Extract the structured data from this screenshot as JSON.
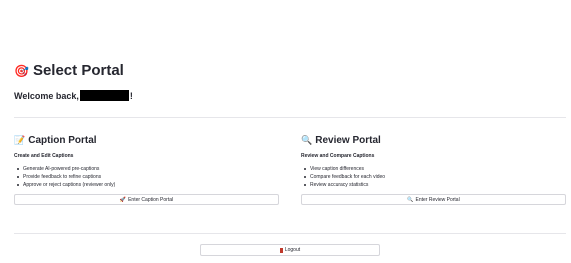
{
  "header": {
    "title": "Select Portal",
    "title_icon": "target-icon",
    "welcome_prefix": "Welcome back,",
    "welcome_suffix": "!"
  },
  "caption_portal": {
    "icon": "memo-icon",
    "title": "Caption Portal",
    "subtitle": "Create and Edit Captions",
    "bullets": [
      "Generate AI-powered pre-captions",
      "Provide feedback to refine captions",
      "Approve or reject captions (reviewer only)"
    ],
    "button_label": "Enter Caption Portal",
    "button_icon": "rocket-icon"
  },
  "review_portal": {
    "icon": "magnifier-icon",
    "title": "Review Portal",
    "subtitle": "Review and Compare Captions",
    "bullets": [
      "View caption differences",
      "Compare feedback for each video",
      "Review accuracy statistics"
    ],
    "button_label": "Enter Review Portal",
    "button_icon": "magnifier-icon"
  },
  "logout": {
    "label": "Logout",
    "icon": "door-icon"
  },
  "colors": {
    "text": "#262730",
    "border": "#d6d6db",
    "divider": "#e6e6ea"
  }
}
